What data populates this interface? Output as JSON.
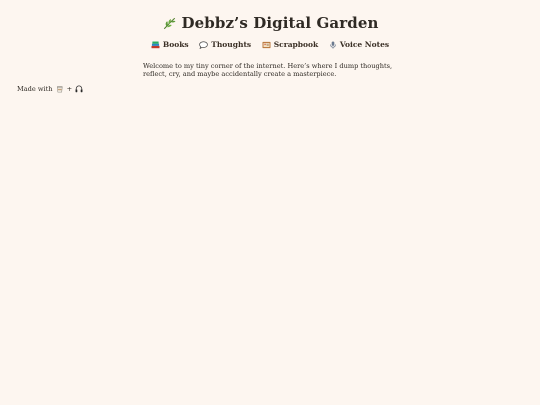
{
  "site": {
    "title": "Debbz’s Digital Garden",
    "icon": "herb-leaf-icon"
  },
  "nav": {
    "items": [
      {
        "label": "Books",
        "icon": "books-icon"
      },
      {
        "label": "Thoughts",
        "icon": "speech-bubble-icon"
      },
      {
        "label": "Scrapbook",
        "icon": "scrapbook-icon"
      },
      {
        "label": "Voice Notes",
        "icon": "microphone-icon"
      }
    ]
  },
  "intro": {
    "text": "Welcome to my tiny corner of the internet. Here’s where I dump thoughts, reflect, cry, and maybe accidentally create a masterpiece."
  },
  "footer": {
    "prefix": "Made with",
    "joiner": "+",
    "icons": [
      "coffee-cup-icon",
      "headphones-icon"
    ]
  },
  "colors": {
    "background": "#fdf6f0",
    "text": "#2f2a24",
    "leaf": "#5d9b3a"
  }
}
